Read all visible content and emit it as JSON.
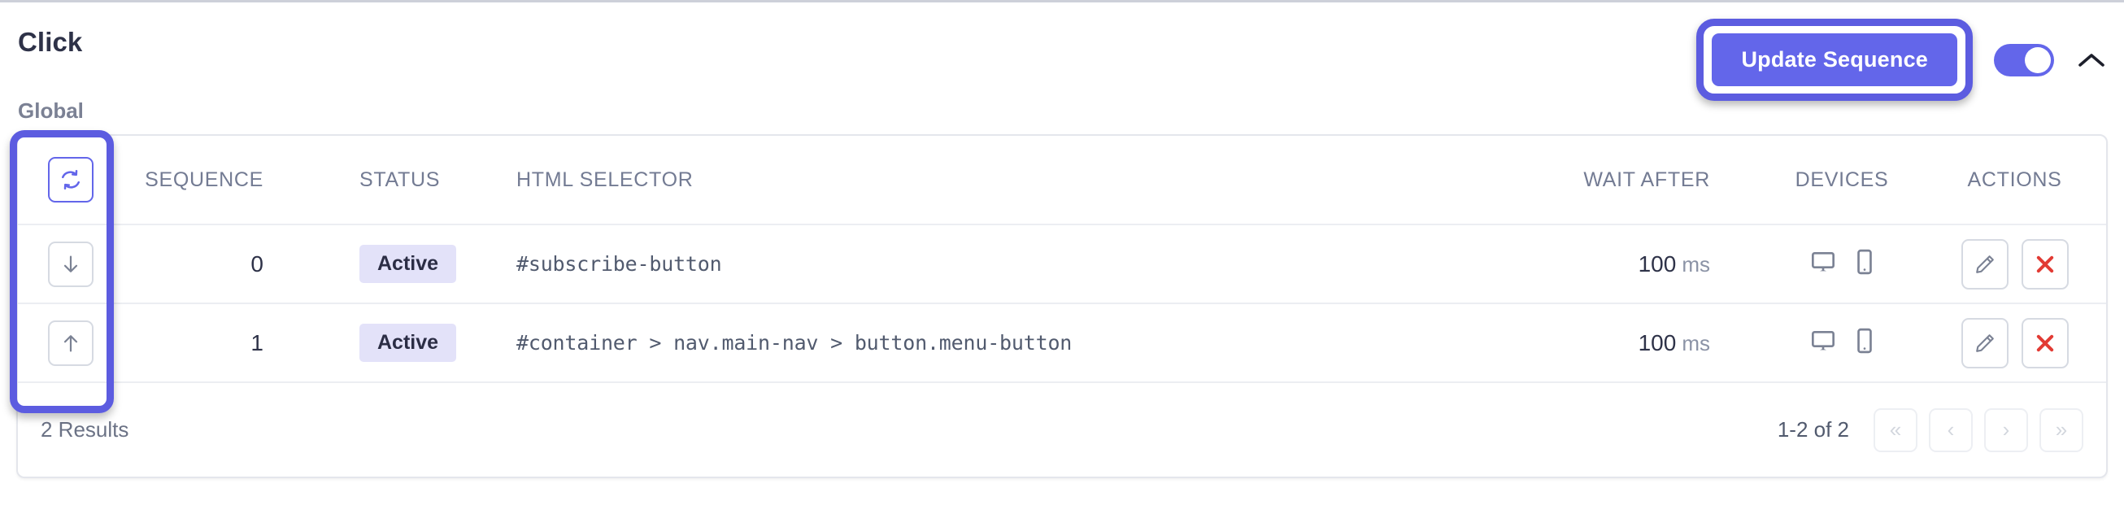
{
  "header": {
    "title": "Click",
    "update_button_label": "Update Sequence",
    "toggle_state": "on",
    "collapse_icon": "chevron-up-icon"
  },
  "group_label": "Global",
  "table": {
    "columns": [
      {
        "key": "handle",
        "label": ""
      },
      {
        "key": "sequence",
        "label": "SEQUENCE"
      },
      {
        "key": "status",
        "label": "STATUS"
      },
      {
        "key": "selector",
        "label": "HTML SELECTOR"
      },
      {
        "key": "wait",
        "label": "WAIT AFTER"
      },
      {
        "key": "devices",
        "label": "DEVICES"
      },
      {
        "key": "actions",
        "label": "ACTIONS"
      }
    ],
    "header_handle_icon": "refresh-icon",
    "rows": [
      {
        "handle_icon": "arrow-down-icon",
        "sequence": "0",
        "status": "Active",
        "selector": "#subscribe-button",
        "wait_value": "100",
        "wait_unit": "ms",
        "devices": [
          "desktop-icon",
          "mobile-icon"
        ],
        "actions": [
          "edit-icon",
          "delete-icon"
        ]
      },
      {
        "handle_icon": "arrow-up-icon",
        "sequence": "1",
        "status": "Active",
        "selector": "#container > nav.main-nav > button.menu-button",
        "wait_value": "100",
        "wait_unit": "ms",
        "devices": [
          "desktop-icon",
          "mobile-icon"
        ],
        "actions": [
          "edit-icon",
          "delete-icon"
        ]
      }
    ]
  },
  "footer": {
    "results_text": "2 Results",
    "range_text": "1-2 of 2",
    "pager": [
      {
        "name": "first-page-button",
        "glyph": "«"
      },
      {
        "name": "prev-page-button",
        "glyph": "‹"
      },
      {
        "name": "next-page-button",
        "glyph": "›"
      },
      {
        "name": "last-page-button",
        "glyph": "»"
      }
    ]
  },
  "colors": {
    "accent": "#6366ea",
    "highlight_ring": "#5c5ce0",
    "badge_bg": "#e3e2f9",
    "badge_text": "#2b2d45",
    "delete_red": "#e23b34",
    "muted_text": "#737b93",
    "border": "#e4e6ec"
  }
}
